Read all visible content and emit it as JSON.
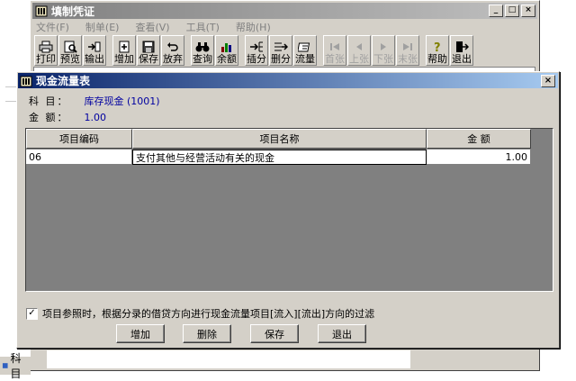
{
  "main_window": {
    "title": "填制凭证",
    "menu": [
      "文件(F)",
      "制单(E)",
      "查看(V)",
      "工具(T)",
      "帮助(H)"
    ],
    "toolbar": [
      {
        "label": "打印",
        "icon": "print-icon",
        "enabled": true
      },
      {
        "label": "预览",
        "icon": "preview-icon",
        "enabled": true
      },
      {
        "label": "输出",
        "icon": "export-icon",
        "enabled": true
      },
      {
        "label": "增加",
        "icon": "add-icon",
        "enabled": true
      },
      {
        "label": "保存",
        "icon": "save-icon",
        "enabled": true
      },
      {
        "label": "放弃",
        "icon": "undo-icon",
        "enabled": true
      },
      {
        "label": "查询",
        "icon": "binoculars-icon",
        "enabled": true
      },
      {
        "label": "余额",
        "icon": "balance-chart-icon",
        "enabled": true
      },
      {
        "label": "插分",
        "icon": "insert-entry-icon",
        "enabled": true
      },
      {
        "label": "删分",
        "icon": "delete-entry-icon",
        "enabled": true
      },
      {
        "label": "流量",
        "icon": "cashflow-icon",
        "enabled": true
      },
      {
        "label": "首张",
        "icon": "first-record-icon",
        "enabled": false
      },
      {
        "label": "上张",
        "icon": "prev-record-icon",
        "enabled": false
      },
      {
        "label": "下张",
        "icon": "next-record-icon",
        "enabled": false
      },
      {
        "label": "末张",
        "icon": "last-record-icon",
        "enabled": false
      },
      {
        "label": "帮助",
        "icon": "help-icon",
        "enabled": true
      },
      {
        "label": "退出",
        "icon": "exit-icon",
        "enabled": true
      }
    ],
    "window_buttons": {
      "minimize": "_",
      "maximize": "□",
      "close": "×"
    }
  },
  "dialog": {
    "title": "现金流量表",
    "close_glyph": "×",
    "subject_label": "科 目：",
    "subject_value": "库存现金 (1001)",
    "amount_label": "金 额：",
    "amount_value": "1.00",
    "columns": [
      "项目编码",
      "项目名称",
      "金 额"
    ],
    "rows": [
      {
        "code": "06",
        "name": "支付其他与经营活动有关的现金",
        "amount": "1.00"
      }
    ],
    "checkbox_checked": true,
    "checkbox_label": "项目参照时，根据分录的借贷方向进行现金流量项目[流入][流出]方向的过滤",
    "buttons": [
      "增加",
      "删除",
      "保存",
      "退出"
    ]
  },
  "background": {
    "left_label": "科目"
  }
}
